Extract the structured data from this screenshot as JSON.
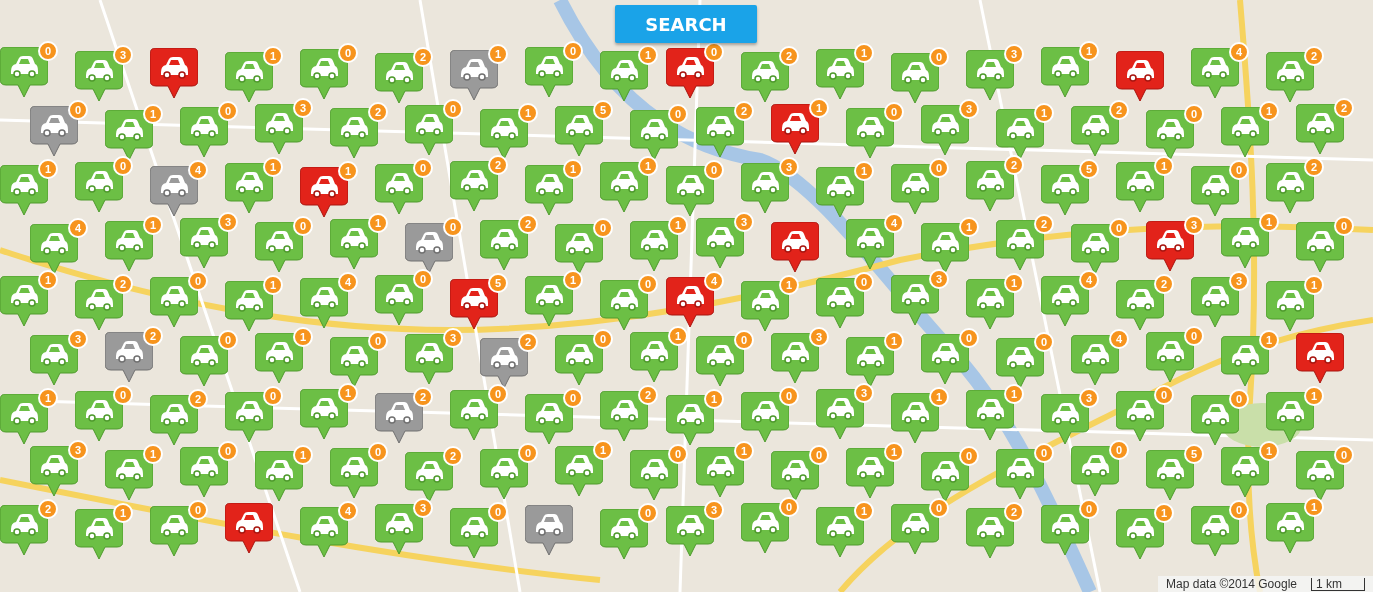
{
  "search_button": {
    "label": "SEARCH"
  },
  "pins": [
    {
      "kind": "available",
      "count": "0"
    },
    {
      "kind": "available",
      "count": "3"
    },
    {
      "kind": "full"
    },
    {
      "kind": "available",
      "count": "1"
    },
    {
      "kind": "available",
      "count": "0"
    },
    {
      "kind": "available",
      "count": "2"
    },
    {
      "kind": "offline",
      "count": "1"
    },
    {
      "kind": "available",
      "count": "0"
    },
    {
      "kind": "available",
      "count": "1"
    },
    {
      "kind": "full",
      "count": "0"
    },
    {
      "kind": "available",
      "count": "2"
    },
    {
      "kind": "available",
      "count": "1"
    },
    {
      "kind": "available",
      "count": "0"
    },
    {
      "kind": "available",
      "count": "3"
    },
    {
      "kind": "available",
      "count": "1"
    },
    {
      "kind": "full"
    },
    {
      "kind": "available",
      "count": "4"
    },
    {
      "kind": "available",
      "count": "2"
    },
    {
      "kind": "offline",
      "count": "0"
    },
    {
      "kind": "available",
      "count": "1"
    },
    {
      "kind": "available",
      "count": "0"
    },
    {
      "kind": "available",
      "count": "3"
    },
    {
      "kind": "available",
      "count": "2"
    },
    {
      "kind": "available",
      "count": "0"
    },
    {
      "kind": "available",
      "count": "1"
    },
    {
      "kind": "available",
      "count": "5"
    },
    {
      "kind": "available",
      "count": "0"
    },
    {
      "kind": "available",
      "count": "2"
    },
    {
      "kind": "full",
      "count": "1"
    },
    {
      "kind": "available",
      "count": "0"
    },
    {
      "kind": "available",
      "count": "3"
    },
    {
      "kind": "available",
      "count": "1"
    },
    {
      "kind": "available",
      "count": "2"
    },
    {
      "kind": "available",
      "count": "0"
    },
    {
      "kind": "available",
      "count": "1"
    },
    {
      "kind": "available",
      "count": "2"
    },
    {
      "kind": "available",
      "count": "1"
    },
    {
      "kind": "available",
      "count": "0"
    },
    {
      "kind": "offline",
      "count": "4"
    },
    {
      "kind": "available",
      "count": "1"
    },
    {
      "kind": "full",
      "count": "1"
    },
    {
      "kind": "available",
      "count": "0"
    },
    {
      "kind": "available",
      "count": "2"
    },
    {
      "kind": "available",
      "count": "1"
    },
    {
      "kind": "available",
      "count": "1"
    },
    {
      "kind": "available",
      "count": "0"
    },
    {
      "kind": "available",
      "count": "3"
    },
    {
      "kind": "available",
      "count": "1"
    },
    {
      "kind": "available",
      "count": "0"
    },
    {
      "kind": "available",
      "count": "2"
    },
    {
      "kind": "available",
      "count": "5"
    },
    {
      "kind": "available",
      "count": "1"
    },
    {
      "kind": "available",
      "count": "0"
    },
    {
      "kind": "available",
      "count": "2"
    },
    {
      "kind": "available",
      "count": "4"
    },
    {
      "kind": "available",
      "count": "1"
    },
    {
      "kind": "available",
      "count": "3"
    },
    {
      "kind": "available",
      "count": "0"
    },
    {
      "kind": "available",
      "count": "1"
    },
    {
      "kind": "offline",
      "count": "0"
    },
    {
      "kind": "available",
      "count": "2"
    },
    {
      "kind": "available",
      "count": "0"
    },
    {
      "kind": "available",
      "count": "1"
    },
    {
      "kind": "available",
      "count": "3"
    },
    {
      "kind": "full"
    },
    {
      "kind": "available",
      "count": "4"
    },
    {
      "kind": "available",
      "count": "1"
    },
    {
      "kind": "available",
      "count": "2"
    },
    {
      "kind": "available",
      "count": "0"
    },
    {
      "kind": "full",
      "count": "3"
    },
    {
      "kind": "available",
      "count": "1"
    },
    {
      "kind": "available",
      "count": "0"
    },
    {
      "kind": "available",
      "count": "1"
    },
    {
      "kind": "available",
      "count": "2"
    },
    {
      "kind": "available",
      "count": "0"
    },
    {
      "kind": "available",
      "count": "1"
    },
    {
      "kind": "available",
      "count": "4"
    },
    {
      "kind": "available",
      "count": "0"
    },
    {
      "kind": "full",
      "count": "5"
    },
    {
      "kind": "available",
      "count": "1"
    },
    {
      "kind": "available",
      "count": "0"
    },
    {
      "kind": "full",
      "count": "4"
    },
    {
      "kind": "available",
      "count": "1"
    },
    {
      "kind": "available",
      "count": "0"
    },
    {
      "kind": "available",
      "count": "3"
    },
    {
      "kind": "available",
      "count": "1"
    },
    {
      "kind": "available",
      "count": "4"
    },
    {
      "kind": "available",
      "count": "2"
    },
    {
      "kind": "available",
      "count": "3"
    },
    {
      "kind": "available",
      "count": "1"
    },
    {
      "kind": "available",
      "count": "3"
    },
    {
      "kind": "offline",
      "count": "2"
    },
    {
      "kind": "available",
      "count": "0"
    },
    {
      "kind": "available",
      "count": "1"
    },
    {
      "kind": "available",
      "count": "0"
    },
    {
      "kind": "available",
      "count": "3"
    },
    {
      "kind": "offline",
      "count": "2"
    },
    {
      "kind": "available",
      "count": "0"
    },
    {
      "kind": "available",
      "count": "1"
    },
    {
      "kind": "available",
      "count": "0"
    },
    {
      "kind": "available",
      "count": "3"
    },
    {
      "kind": "available",
      "count": "1"
    },
    {
      "kind": "available",
      "count": "0"
    },
    {
      "kind": "available",
      "count": "0"
    },
    {
      "kind": "available",
      "count": "4"
    },
    {
      "kind": "available",
      "count": "0"
    },
    {
      "kind": "available",
      "count": "1"
    },
    {
      "kind": "full"
    },
    {
      "kind": "available",
      "count": "1"
    },
    {
      "kind": "available",
      "count": "0"
    },
    {
      "kind": "available",
      "count": "2"
    },
    {
      "kind": "available",
      "count": "0"
    },
    {
      "kind": "available",
      "count": "1"
    },
    {
      "kind": "offline",
      "count": "2"
    },
    {
      "kind": "available",
      "count": "0"
    },
    {
      "kind": "available",
      "count": "0"
    },
    {
      "kind": "available",
      "count": "2"
    },
    {
      "kind": "available",
      "count": "1"
    },
    {
      "kind": "available",
      "count": "0"
    },
    {
      "kind": "available",
      "count": "3"
    },
    {
      "kind": "available",
      "count": "1"
    },
    {
      "kind": "available",
      "count": "1"
    },
    {
      "kind": "available",
      "count": "3"
    },
    {
      "kind": "available",
      "count": "0"
    },
    {
      "kind": "available",
      "count": "0"
    },
    {
      "kind": "available",
      "count": "1"
    },
    {
      "kind": "available",
      "count": "3"
    },
    {
      "kind": "available",
      "count": "1"
    },
    {
      "kind": "available",
      "count": "0"
    },
    {
      "kind": "available",
      "count": "1"
    },
    {
      "kind": "available",
      "count": "0"
    },
    {
      "kind": "available",
      "count": "2"
    },
    {
      "kind": "available",
      "count": "0"
    },
    {
      "kind": "available",
      "count": "1"
    },
    {
      "kind": "available",
      "count": "0"
    },
    {
      "kind": "available",
      "count": "1"
    },
    {
      "kind": "available",
      "count": "0"
    },
    {
      "kind": "available",
      "count": "1"
    },
    {
      "kind": "available",
      "count": "0"
    },
    {
      "kind": "available",
      "count": "0"
    },
    {
      "kind": "available",
      "count": "0"
    },
    {
      "kind": "available",
      "count": "5"
    },
    {
      "kind": "available",
      "count": "1"
    },
    {
      "kind": "available",
      "count": "0"
    },
    {
      "kind": "available",
      "count": "2"
    },
    {
      "kind": "available",
      "count": "1"
    },
    {
      "kind": "available",
      "count": "0"
    },
    {
      "kind": "full"
    },
    {
      "kind": "available",
      "count": "4"
    },
    {
      "kind": "available",
      "count": "3"
    },
    {
      "kind": "available",
      "count": "0"
    },
    {
      "kind": "offline"
    },
    {
      "kind": "available",
      "count": "0"
    },
    {
      "kind": "available",
      "count": "3"
    },
    {
      "kind": "available",
      "count": "0"
    },
    {
      "kind": "available",
      "count": "1"
    },
    {
      "kind": "available",
      "count": "0"
    },
    {
      "kind": "available",
      "count": "2"
    },
    {
      "kind": "available",
      "count": "0"
    },
    {
      "kind": "available",
      "count": "1"
    },
    {
      "kind": "available",
      "count": "0"
    },
    {
      "kind": "available",
      "count": "1"
    }
  ],
  "attribution": "Map data ©2014 Google",
  "scale": "1 km"
}
